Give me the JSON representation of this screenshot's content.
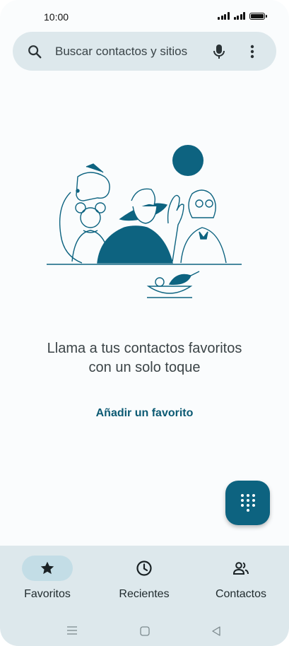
{
  "status_bar": {
    "time": "10:00"
  },
  "search": {
    "placeholder": "Buscar contactos y sitios"
  },
  "empty_state": {
    "title": "Llama a tus contactos favoritos con un solo toque",
    "action": "Añadir un favorito"
  },
  "colors": {
    "accent": "#0d6380",
    "nav_bg": "#dde8ec",
    "active_pill": "#c3dde6"
  },
  "bottom_nav": {
    "items": [
      {
        "label": "Favoritos",
        "icon": "star-icon",
        "active": true
      },
      {
        "label": "Recientes",
        "icon": "clock-icon",
        "active": false
      },
      {
        "label": "Contactos",
        "icon": "people-icon",
        "active": false
      }
    ]
  },
  "system_nav": {
    "icons": [
      "menu-icon",
      "home-icon",
      "back-icon"
    ]
  }
}
